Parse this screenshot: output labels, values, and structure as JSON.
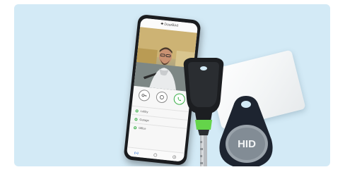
{
  "phone": {
    "brand_name": "DoorBird",
    "controls": [
      {
        "icon": "key-icon"
      },
      {
        "icon": "chat-icon"
      },
      {
        "icon": "phone-call-icon"
      }
    ],
    "locations": [
      {
        "label": "Lobby"
      },
      {
        "label": "Garage"
      },
      {
        "label": "Office"
      }
    ],
    "tabs": [
      {
        "icon": "broadcast-icon"
      },
      {
        "icon": "home-icon"
      },
      {
        "icon": "settings-icon"
      }
    ]
  },
  "key_fob": {
    "brand_text": "HID"
  },
  "colors": {
    "background_panel": "#d3eaf6",
    "accent_green": "#3cb04a",
    "fob_ring": "#1d2430",
    "fob_inlay": "#9aa3ab"
  }
}
